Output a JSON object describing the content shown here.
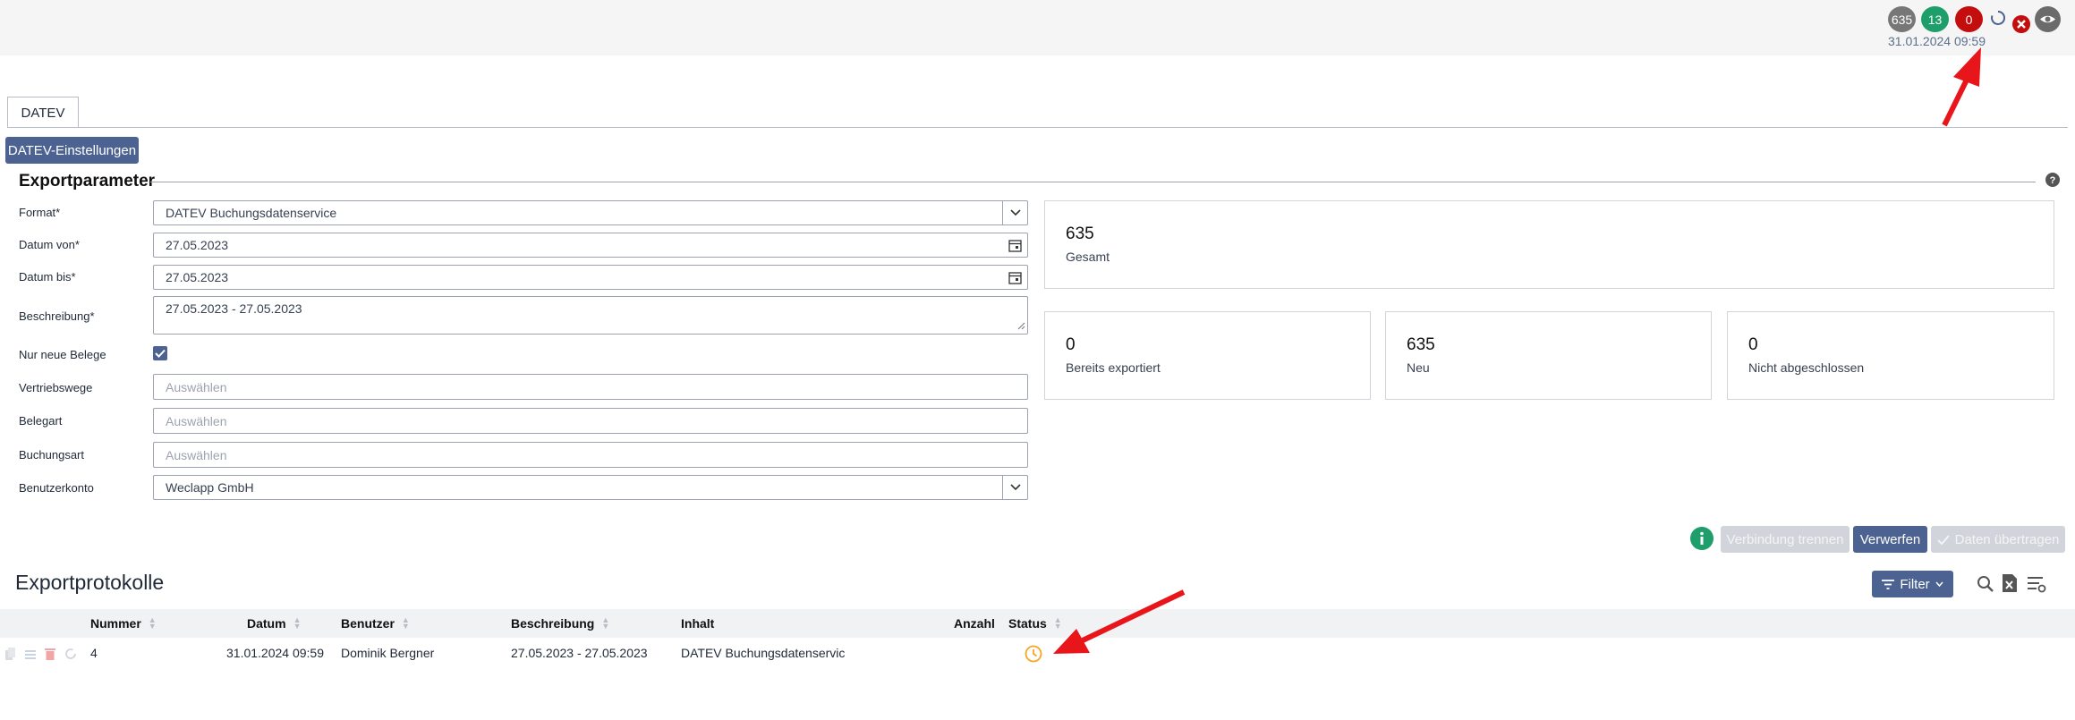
{
  "header": {
    "badges": [
      {
        "label": "635",
        "color": "#777777"
      },
      {
        "label": "13",
        "color": "#1e9e6a"
      },
      {
        "label": "0",
        "color": "#c40d0d"
      }
    ],
    "timestamp": "31.01.2024 09:59",
    "icons": [
      "loading-spinner-icon",
      "error-x-icon",
      "eye-icon"
    ]
  },
  "tabs": [
    {
      "label": "DATEV"
    }
  ],
  "settings_button": "DATEV-Einstellungen",
  "export_params": {
    "title": "Exportparameter",
    "help_icon": "help-icon",
    "fields": {
      "format": {
        "label": "Format*",
        "value": "DATEV Buchungsdatenservice"
      },
      "date_from": {
        "label": "Datum von*",
        "value": "27.05.2023"
      },
      "date_to": {
        "label": "Datum bis*",
        "value": "27.05.2023"
      },
      "description": {
        "label": "Beschreibung*",
        "value": "27.05.2023 - 27.05.2023"
      },
      "only_new": {
        "label": "Nur neue Belege",
        "checked": true
      },
      "sales_channels": {
        "label": "Vertriebswege",
        "placeholder": "Auswählen"
      },
      "doc_type": {
        "label": "Belegart",
        "placeholder": "Auswählen"
      },
      "booking_type": {
        "label": "Buchungsart",
        "placeholder": "Auswählen"
      },
      "account": {
        "label": "Benutzerkonto",
        "value": "Weclapp GmbH"
      }
    }
  },
  "stats": {
    "total": {
      "value": "635",
      "label": "Gesamt"
    },
    "exported": {
      "value": "0",
      "label": "Bereits exportiert"
    },
    "new": {
      "value": "635",
      "label": "Neu"
    },
    "incomplete": {
      "value": "0",
      "label": "Nicht abgeschlossen"
    }
  },
  "actions": {
    "disconnect": "Verbindung trennen",
    "discard": "Verwerfen",
    "transfer": "Daten übertragen"
  },
  "protocol": {
    "title": "Exportprotokolle",
    "filter_label": "Filter",
    "columns": [
      "Nummer",
      "Datum",
      "Benutzer",
      "Beschreibung",
      "Inhalt",
      "Anzahl",
      "Status"
    ],
    "rows": [
      {
        "nummer": "4",
        "datum": "31.01.2024 09:59",
        "benutzer": "Dominik Bergner",
        "beschreibung": "27.05.2023 - 27.05.2023",
        "inhalt": "DATEV Buchungsdatenservic",
        "anzahl": "",
        "status_icon": "clock-icon"
      }
    ]
  },
  "annotation_color": "#e8161b"
}
